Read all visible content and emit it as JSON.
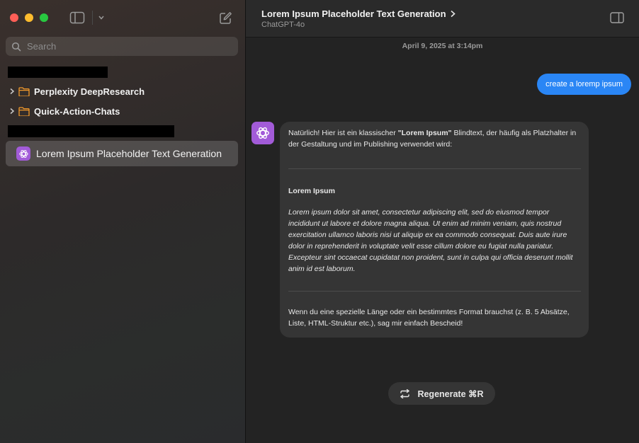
{
  "sidebar": {
    "search_placeholder": "Search",
    "folders": [
      {
        "label": "Perplexity DeepResearch"
      },
      {
        "label": "Quick-Action-Chats"
      }
    ],
    "active_chat": {
      "label": "Lorem Ipsum Placeholder Text Generation"
    }
  },
  "header": {
    "title": "Lorem Ipsum Placeholder Text Generation",
    "model": "ChatGPT-4o"
  },
  "conversation": {
    "timestamp": "April 9, 2025 at 3:14pm",
    "user_message": "create a loremp ipsum",
    "assistant": {
      "intro_before": "Natürlich! Hier ist ein klassischer ",
      "intro_bold": "\"Lorem Ipsum\"",
      "intro_after": " Blindtext, der häufig als Platzhalter in der Gestaltung und im Publishing verwendet wird:",
      "heading": "Lorem Ipsum",
      "lorem": "Lorem ipsum dolor sit amet, consectetur adipiscing elit, sed do eiusmod tempor incididunt ut labore et dolore magna aliqua. Ut enim ad minim veniam, quis nostrud exercitation ullamco laboris nisi ut aliquip ex ea commodo consequat. Duis aute irure dolor in reprehenderit in voluptate velit esse cillum dolore eu fugiat nulla pariatur. Excepteur sint occaecat cupidatat non proident, sunt in culpa qui officia deserunt mollit anim id est laborum.",
      "outro": "Wenn du eine spezielle Länge oder ein bestimmtes Format brauchst (z. B. 5 Absätze, Liste, HTML-Struktur etc.), sag mir einfach Bescheid!"
    }
  },
  "regenerate_label": "Regenerate ⌘R",
  "icons": {
    "sidebar_toggle": "sidebar-toggle-icon",
    "compose": "compose-icon",
    "search": "search-icon",
    "folder": "folder-icon",
    "chatgpt": "chatgpt-logo-icon",
    "right_panel": "right-panel-icon",
    "regenerate": "regenerate-icon"
  },
  "colors": {
    "user_bubble": "#2a86f5",
    "app_icon": "#a25bd8",
    "folder": "#f39a2b"
  }
}
